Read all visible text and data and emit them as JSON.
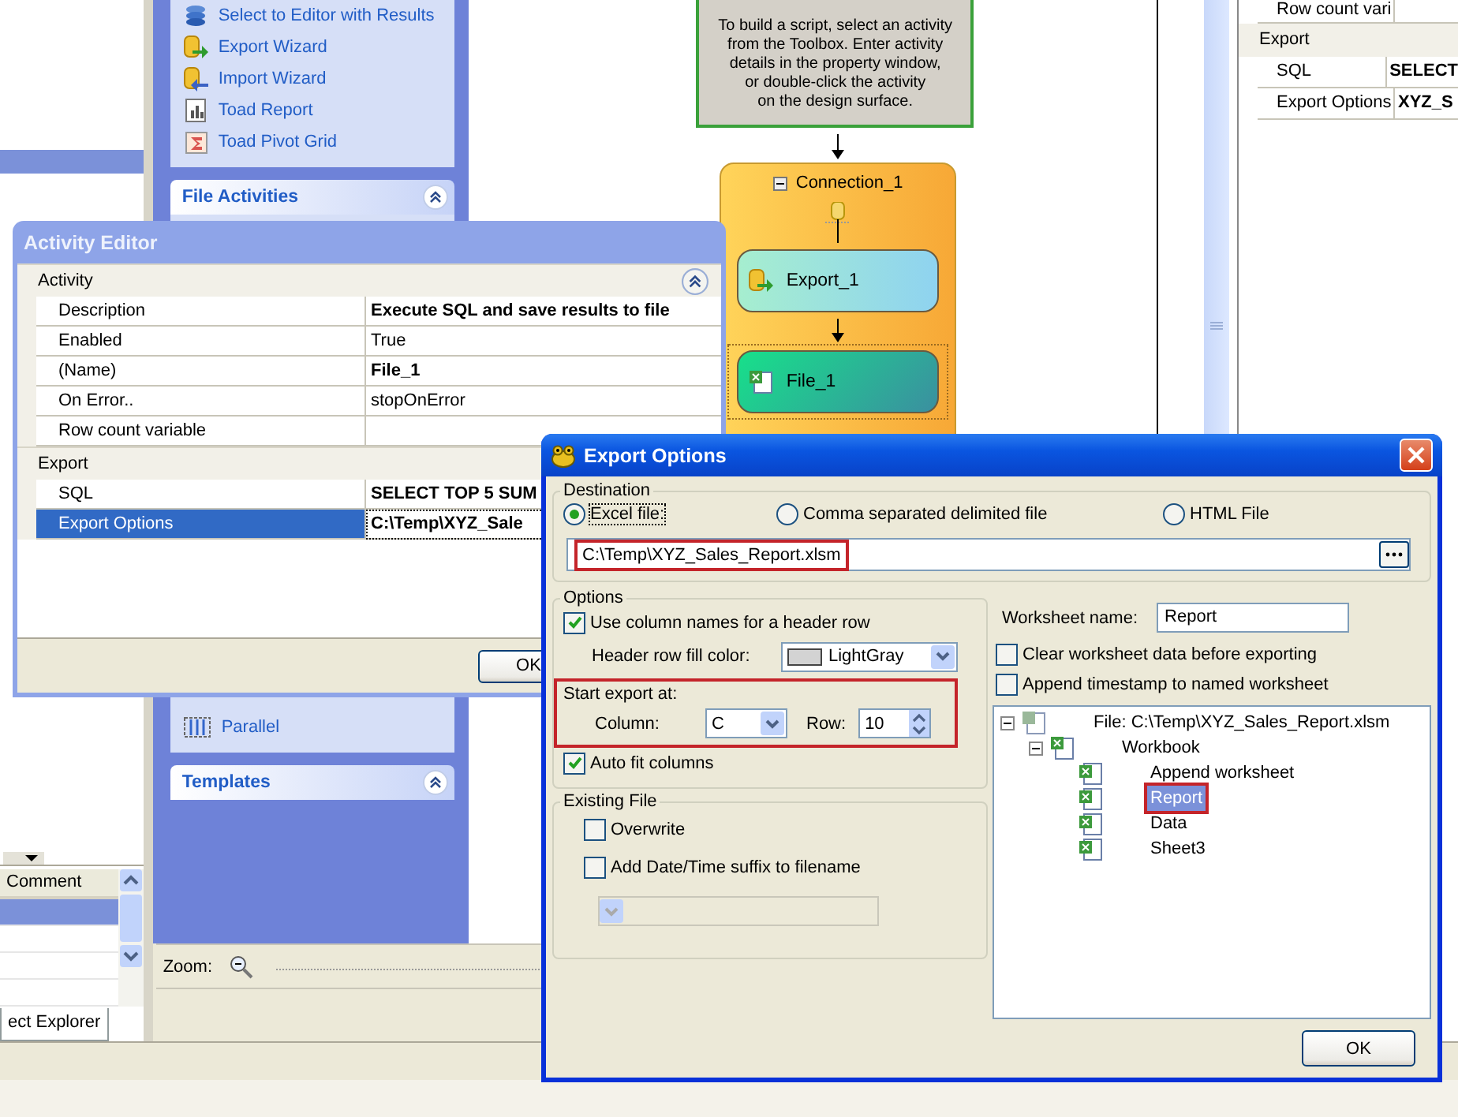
{
  "left_pane": {
    "grid_header": "Comment",
    "grid_rows": [
      {
        "selected": true
      },
      {
        "selected": false
      },
      {
        "selected": false
      },
      {
        "selected": false
      }
    ],
    "tab": "ect Explorer"
  },
  "toolbox": {
    "items": [
      {
        "label": "Select to Editor with Results",
        "kind": "grid"
      },
      {
        "label": "Export Wizard",
        "kind": "export"
      },
      {
        "label": "Import Wizard",
        "kind": "import"
      },
      {
        "label": "Toad Report",
        "kind": "report"
      },
      {
        "label": "Toad Pivot Grid",
        "kind": "pivot"
      }
    ],
    "section_title": "File Activities",
    "bottom_items": [
      {
        "label": "Parallel",
        "kind": "parallel"
      }
    ],
    "last_section_title": "Templates"
  },
  "canvas": {
    "info_text": "To build a script, select an activity\nfrom the Toolbox. Enter activity\ndetails in the property window,\nor double-click the activity\non the design surface.",
    "connection": {
      "title": "Connection_1",
      "expanded": true
    },
    "activities": [
      {
        "label": "Export_1",
        "kind": "export",
        "selected": false
      },
      {
        "label": "File_1",
        "kind": "file",
        "selected": true
      }
    ]
  },
  "zoom_label": "Zoom:",
  "properties_panel": {
    "rows": [
      {
        "kind": "row",
        "name": "Row count vari"
      },
      {
        "kind": "category",
        "name": "Export"
      },
      {
        "kind": "row",
        "name": "SQL",
        "value": "SELECT"
      },
      {
        "kind": "row",
        "name": "Export Options",
        "value": "XYZ_S"
      }
    ]
  },
  "activity_editor": {
    "title": "Activity Editor",
    "sections": [
      {
        "title": "Activity",
        "collapsible": true,
        "rows": [
          {
            "name": "Description",
            "value": "Execute SQL and save results to file",
            "bold": true,
            "selected": false
          },
          {
            "name": "Enabled",
            "value": "True",
            "bold": false,
            "selected": false
          },
          {
            "name": "(Name)",
            "value": "File_1",
            "bold": true,
            "selected": false
          },
          {
            "name": "On Error..",
            "value": "stopOnError",
            "bold": false,
            "selected": false
          },
          {
            "name": "Row count variable",
            "selected": false
          }
        ]
      },
      {
        "title": "Export",
        "collapsible": false,
        "rows": [
          {
            "name": "SQL",
            "value": "SELECT TOP 5 SUM",
            "bold": true,
            "selected": false
          },
          {
            "name": "Export Options",
            "value": "C:\\Temp\\XYZ_Sale",
            "bold": true,
            "selected": true
          }
        ]
      }
    ],
    "ok": "OK"
  },
  "export_dialog": {
    "title": "Export Options",
    "destination": {
      "legend": "Destination",
      "options": [
        {
          "label": "Excel file:",
          "selected": true
        },
        {
          "label": "Comma separated delimited file",
          "selected": false
        },
        {
          "label": "HTML File",
          "selected": false
        }
      ],
      "path": {
        "value": "C:\\Temp\\XYZ_Sales_Report.xlsm",
        "highlighted": true
      }
    },
    "options": {
      "legend": "Options",
      "header_row": {
        "label": "Use column names for a header row",
        "checked": true
      },
      "fill_color": {
        "label": "Header row fill color:",
        "value": "LightGray"
      },
      "start_export": {
        "label": "Start export at:",
        "highlighted": true,
        "column_label": "Column:",
        "column": "C",
        "row_label": "Row:",
        "row": "10"
      },
      "auto_fit": {
        "label": "Auto fit columns",
        "checked": true
      }
    },
    "existing_file": {
      "legend": "Existing File",
      "checks": [
        {
          "label": "Overwrite",
          "checked": false
        },
        {
          "label": "Add Date/Time suffix to filename",
          "checked": false
        }
      ],
      "suffix_dropdown": {
        "disabled": true
      }
    },
    "worksheet": {
      "label": "Worksheet name:",
      "value": "Report",
      "checks": [
        {
          "label": "Clear worksheet data before exporting",
          "checked": false
        },
        {
          "label": "Append timestamp to named worksheet",
          "checked": false
        }
      ]
    },
    "tree": [
      {
        "label": "File: C:\\Temp\\XYZ_Sales_Report.xlsm",
        "kind": "file",
        "expanded": true,
        "selected": false,
        "children": [
          {
            "label": "Workbook",
            "kind": "workbook",
            "expanded": true,
            "selected": false,
            "children": [
              {
                "label": "Append worksheet",
                "kind": "sheet",
                "selected": false,
                "highlighted": false
              },
              {
                "label": "Report",
                "kind": "sheet",
                "selected": true,
                "highlighted": true
              },
              {
                "label": "Data",
                "kind": "sheet",
                "selected": false,
                "highlighted": false
              },
              {
                "label": "Sheet3",
                "kind": "sheet",
                "selected": false,
                "highlighted": false
              }
            ]
          }
        ]
      }
    ],
    "ok": "OK"
  }
}
